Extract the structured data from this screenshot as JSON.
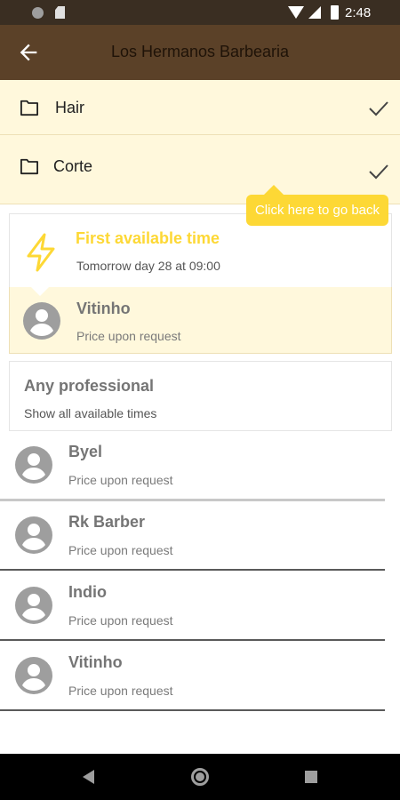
{
  "status_bar": {
    "time": "2:48"
  },
  "header": {
    "title": "Los Hermanos Barbearia"
  },
  "categories": [
    {
      "label": "Hair"
    },
    {
      "label": "Corte"
    }
  ],
  "tooltip": {
    "text": "Click here to go back"
  },
  "first_available": {
    "title": "First available time",
    "subtitle": "Tomorrow day 28 at 09:00",
    "professional": "Vitinho",
    "price": "Price upon request"
  },
  "any_professional": {
    "title": "Any professional",
    "subtitle": "Show all available times"
  },
  "professionals": [
    {
      "name": "Byel",
      "price": "Price upon request"
    },
    {
      "name": "Rk Barber",
      "price": "Price upon request"
    },
    {
      "name": "Indio",
      "price": "Price upon request"
    },
    {
      "name": "Vitinho",
      "price": "Price upon request"
    }
  ],
  "colors": {
    "accent": "#fdd835",
    "app_bar": "#5b4128",
    "highlight": "#fff8dc"
  }
}
